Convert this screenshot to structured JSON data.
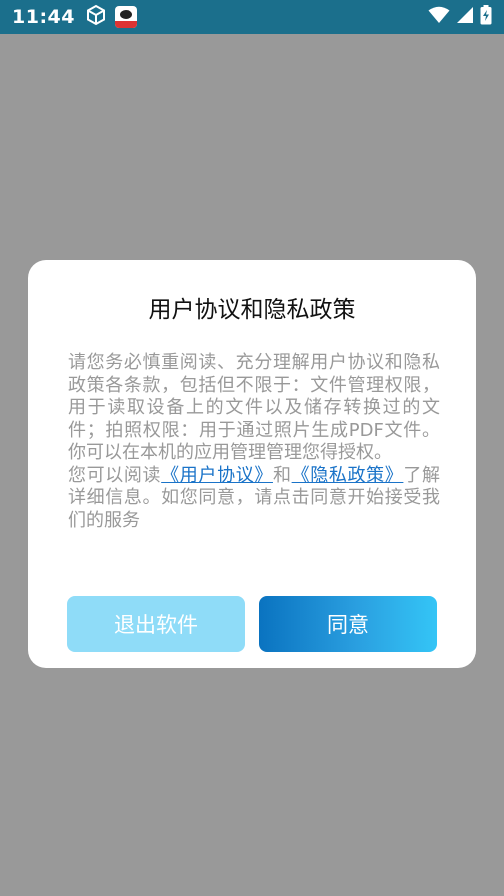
{
  "status_bar": {
    "time": "11:44",
    "left_icons": [
      "cube-icon",
      "app-notification-icon"
    ],
    "right_icons": [
      "wifi-icon",
      "cellular-signal-icon",
      "battery-charging-icon"
    ],
    "background": "#1b6f8c"
  },
  "dialog": {
    "title": "用户协议和隐私政策",
    "paragraph1": "请您务必慎重阅读、充分理解用户协议和隐私政策各条款，包括但不限于：文件管理权限，用于读取设备上的文件以及储存转换过的文件；拍照权限：用于通过照片生成PDF文件。你可以在本机的应用管理管理您得授权。",
    "paragraph2_prefix": "您可以阅读",
    "user_agreement_link": "《用户协议》",
    "and_text": "和",
    "privacy_policy_link": "《隐私政策》",
    "paragraph2_suffix": "了解详细信息。如您同意，请点击同意开始接受我们的服务",
    "exit_button": "退出软件",
    "agree_button": "同意"
  },
  "colors": {
    "overlay": "#999999",
    "link": "#1a73c8",
    "exit_button": "#8fdcf8",
    "agree_gradient_start": "#0a73c0",
    "agree_gradient_end": "#34c5f6"
  }
}
